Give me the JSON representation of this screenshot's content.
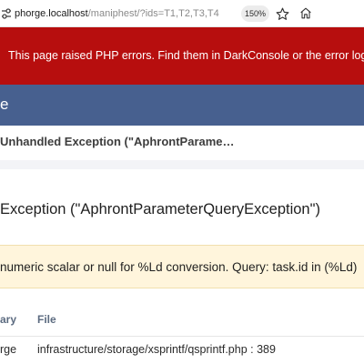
{
  "browser": {
    "url_host": "phorge.localhost",
    "url_rest": "/maniphest/?ids=T1,T2,T3,T4",
    "zoom": "150%"
  },
  "error_banner": {
    "message": "This page raised PHP errors. Find them in DarkConsole or the error log."
  },
  "dialog": {
    "title_fragment": "e",
    "subtitle": "Unhandled Exception (\"AphrontParame…",
    "exception_heading": "Exception (\"AphrontParameterQueryException\")",
    "warning": "numeric scalar or null for %Ld conversion. Query: task.id in (%Ld)"
  },
  "trace_table": {
    "columns": [
      "ary",
      "File"
    ],
    "rows": [
      {
        "library": "rge",
        "file": "infrastructure/storage/xsprintf/qsprintf.php : 389"
      }
    ]
  },
  "colors": {
    "error_red": "#b70e0e",
    "header_blue": "#47608f",
    "warning_bg": "#fff5dc"
  },
  "icons": [
    "tune-icon",
    "star-icon",
    "home-icon"
  ]
}
